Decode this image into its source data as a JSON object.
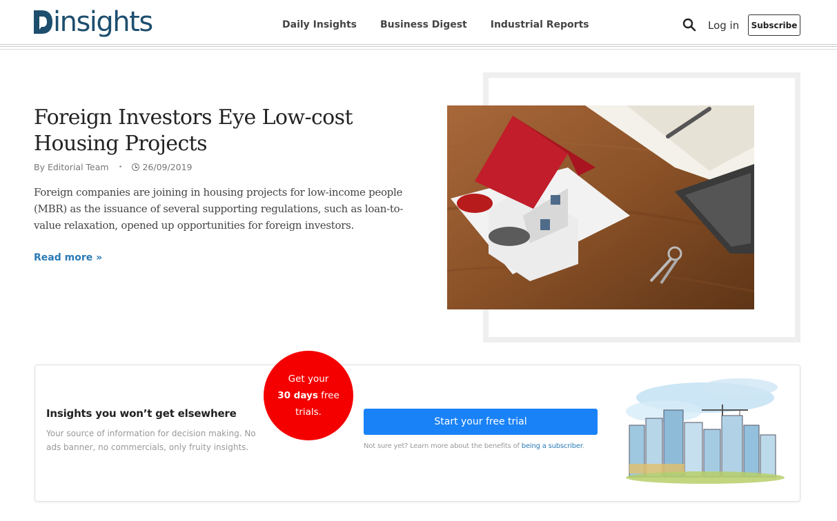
{
  "header": {
    "logo_text": "insights",
    "nav": [
      "Daily Insights",
      "Business Digest",
      "Industrial Reports"
    ],
    "search_icon": "search-icon",
    "login_label": "Log in",
    "subscribe_label": "Subscribe",
    "brand_color": "#1d4e6e"
  },
  "article": {
    "title": "Foreign Investors Eye Low-cost Housing Projects",
    "author": "By Editorial Team",
    "date_icon": "clock-icon",
    "date": "26/09/2019",
    "excerpt": "Foreign companies are joining in housing projects for low-income people (MBR) as the issuance of several supporting regulations, such as loan-to-value relaxation, opened up opportunities for foreign investors.",
    "read_more": "Read more »",
    "link_color": "#2a7ab5"
  },
  "promo": {
    "title": "Insights you won’t get elsewhere",
    "description": "Your source of information for decision making. No ads banner, no commercials, only fruity insights.",
    "badge": {
      "line1": "Get your",
      "emphasis": "30 days",
      "line2_rest": " free",
      "line3": "trials.",
      "color": "#f40000"
    },
    "cta_label": "Start your free trial",
    "cta_color": "#1a82f7",
    "note_prefix": "Not sure yet? Learn more about the benefits of ",
    "note_link": "being a subscriber",
    "note_suffix": "."
  }
}
